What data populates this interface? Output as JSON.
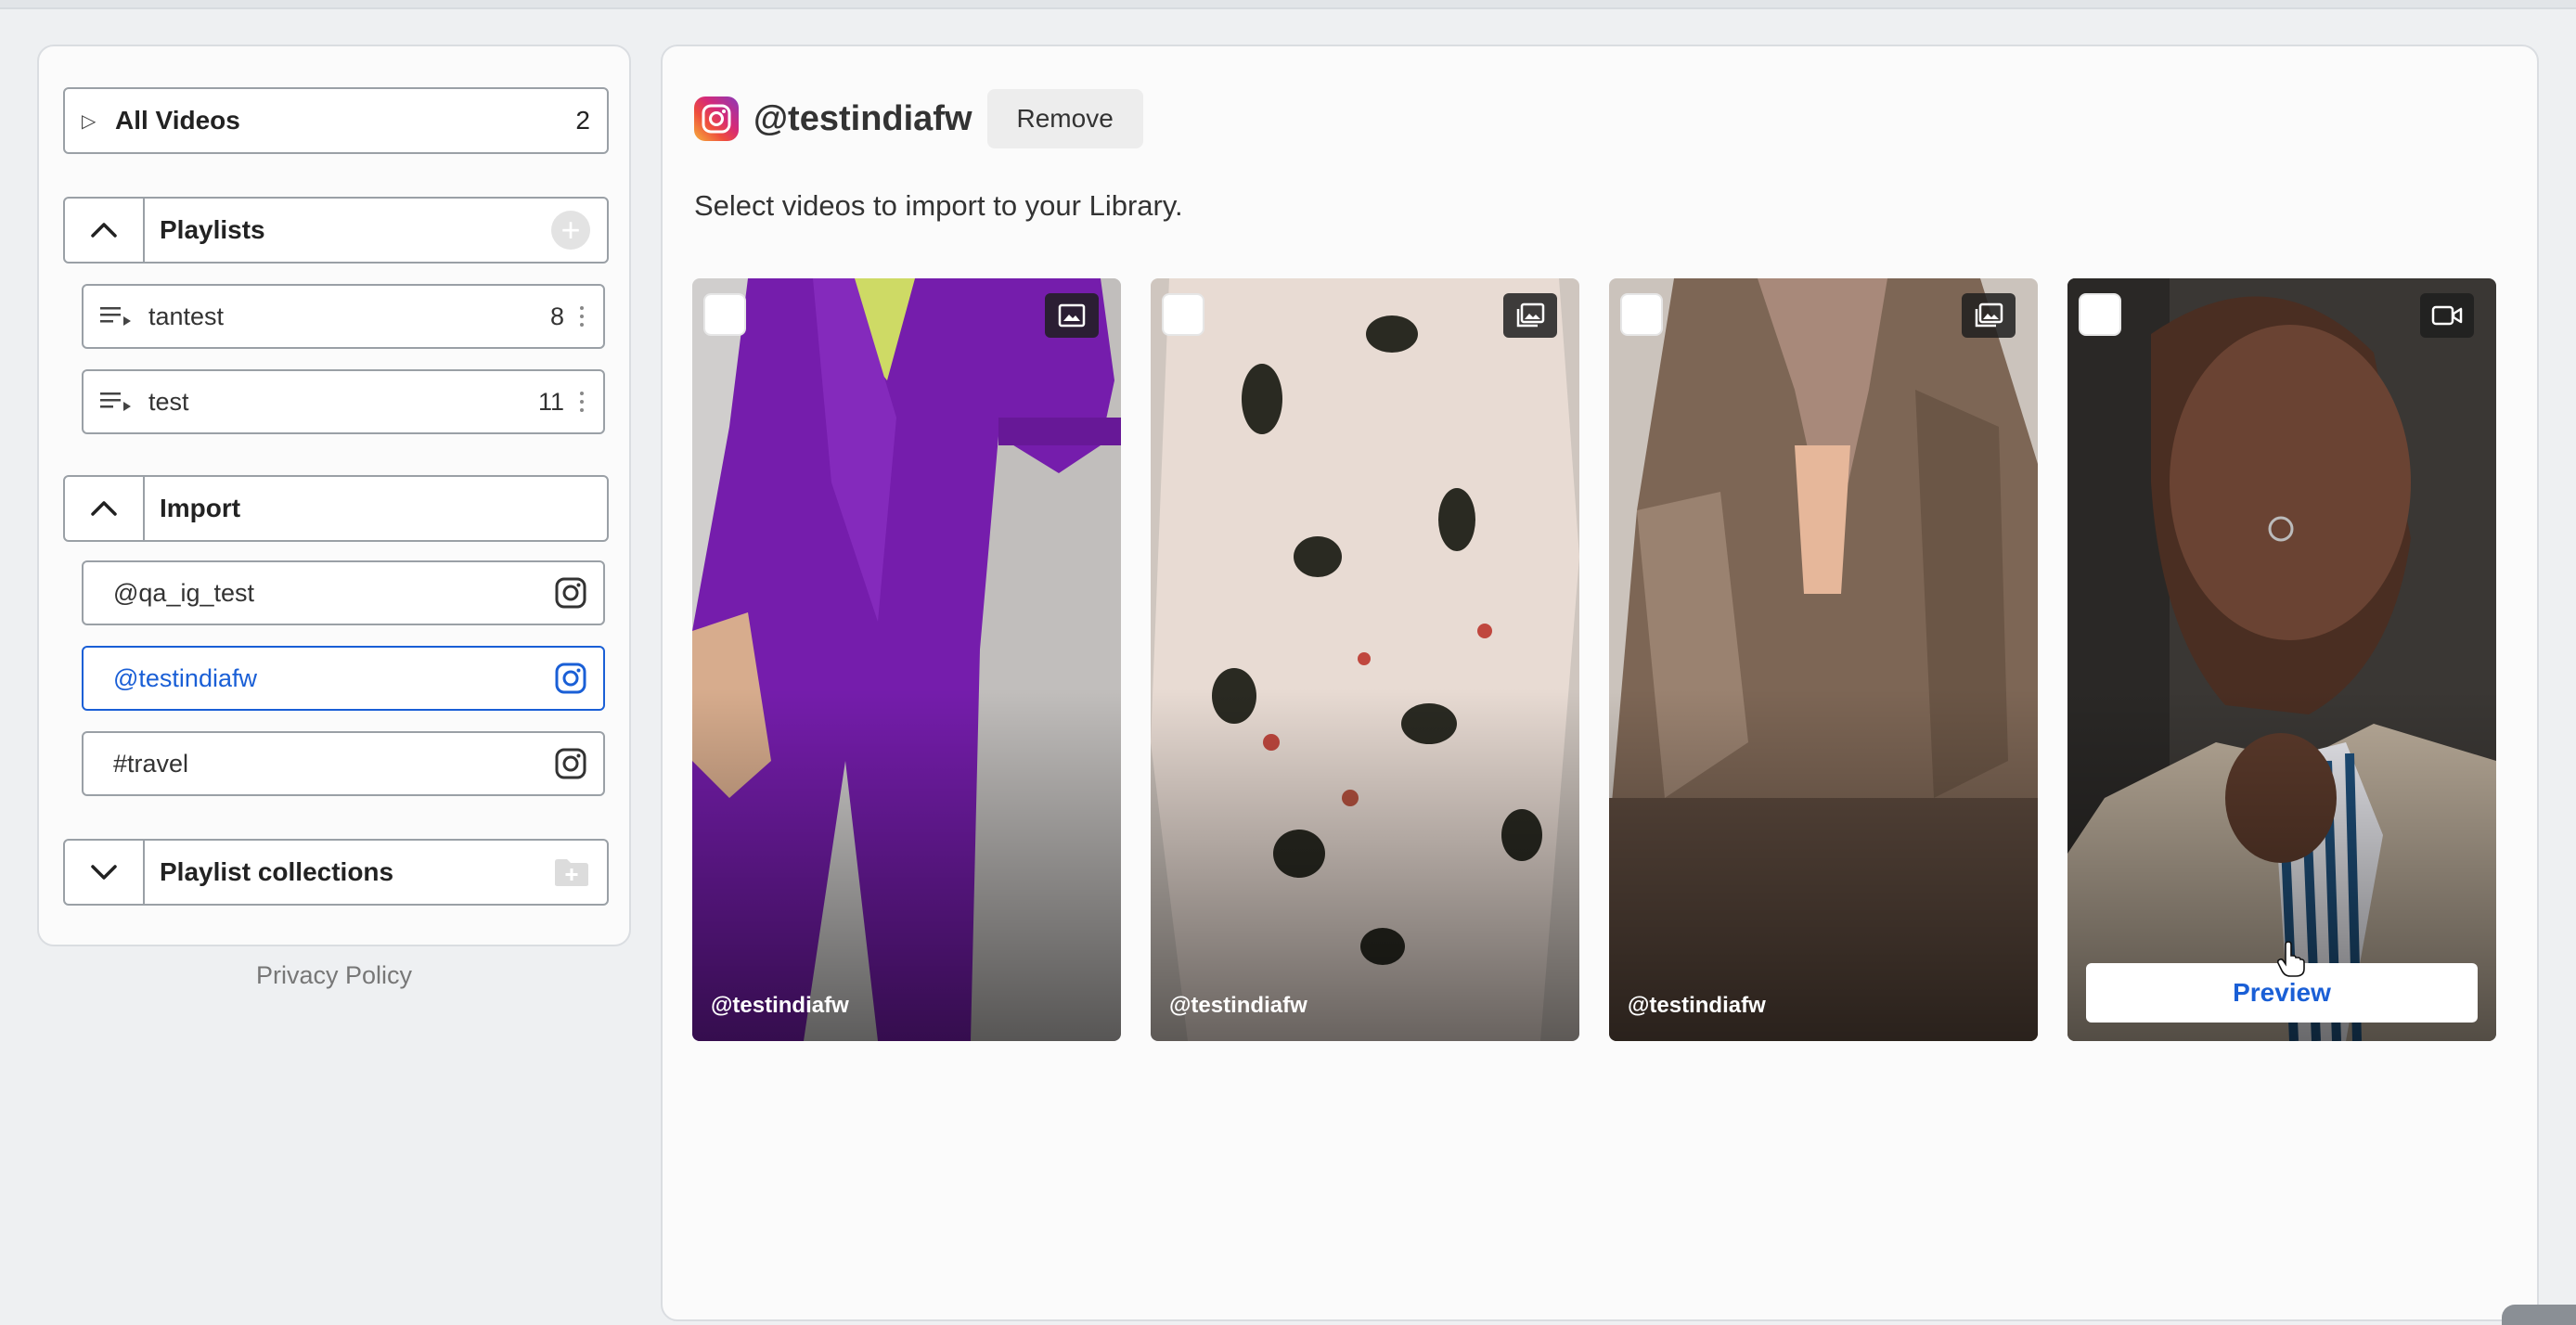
{
  "sidebar": {
    "all_videos": {
      "label": "All Videos",
      "count": "2"
    },
    "playlists": {
      "label": "Playlists",
      "items": [
        {
          "label": "tantest",
          "count": "8"
        },
        {
          "label": "test",
          "count": "11"
        }
      ]
    },
    "import": {
      "label": "Import",
      "items": [
        {
          "label": "@qa_ig_test",
          "icon": "instagram-icon"
        },
        {
          "label": "@testindiafw",
          "icon": "instagram-icon",
          "selected": true
        },
        {
          "label": "#travel",
          "icon": "instagram-icon"
        }
      ]
    },
    "collections": {
      "label": "Playlist collections"
    },
    "privacy": "Privacy Policy"
  },
  "main": {
    "account": "@testindiafw",
    "remove_label": "Remove",
    "subtitle": "Select videos to import to your Library.",
    "cards": [
      {
        "handle": "@testindiafw",
        "type": "image-icon"
      },
      {
        "handle": "@testindiafw",
        "type": "gallery-icon"
      },
      {
        "handle": "@testindiafw",
        "type": "gallery-icon"
      },
      {
        "handle": "",
        "type": "video-icon",
        "preview": "Preview"
      }
    ]
  },
  "colors": {
    "accent": "#1a5fd6",
    "instagram_gradient": [
      "#f6b13c",
      "#ee4d3d",
      "#d62a77",
      "#8a3ab9"
    ]
  }
}
